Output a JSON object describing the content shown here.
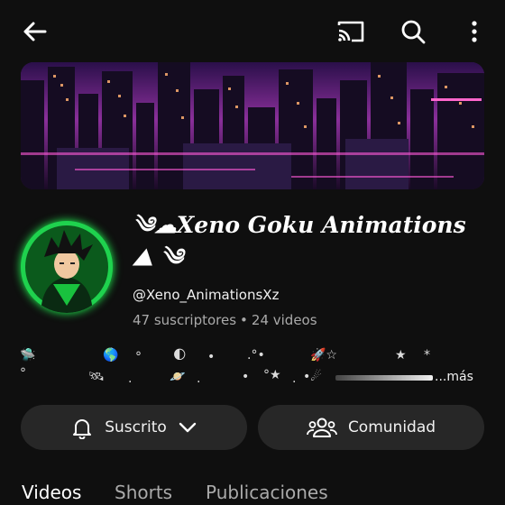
{
  "topbar": {
    "back_icon": "arrow-left-icon",
    "cast_icon": "cast-icon",
    "search_icon": "search-icon",
    "more_icon": "more-vertical-icon"
  },
  "channel": {
    "name_line1": "Xeno Goku Animations",
    "name_line2": "",
    "handle": "@Xeno_AnimationsXz",
    "subscribers": "47 suscriptores",
    "videos": "24 videos",
    "separator": "•"
  },
  "description": {
    "more_label": "...más"
  },
  "actions": {
    "subscribed_label": "Suscrito",
    "community_label": "Comunidad"
  },
  "tabs": [
    {
      "label": "Videos",
      "active": true
    },
    {
      "label": "Shorts",
      "active": false
    },
    {
      "label": "Publicaciones",
      "active": false
    }
  ],
  "colors": {
    "background": "#0f0f0f",
    "button_bg": "#272727",
    "avatar_ring": "#22ff55"
  }
}
